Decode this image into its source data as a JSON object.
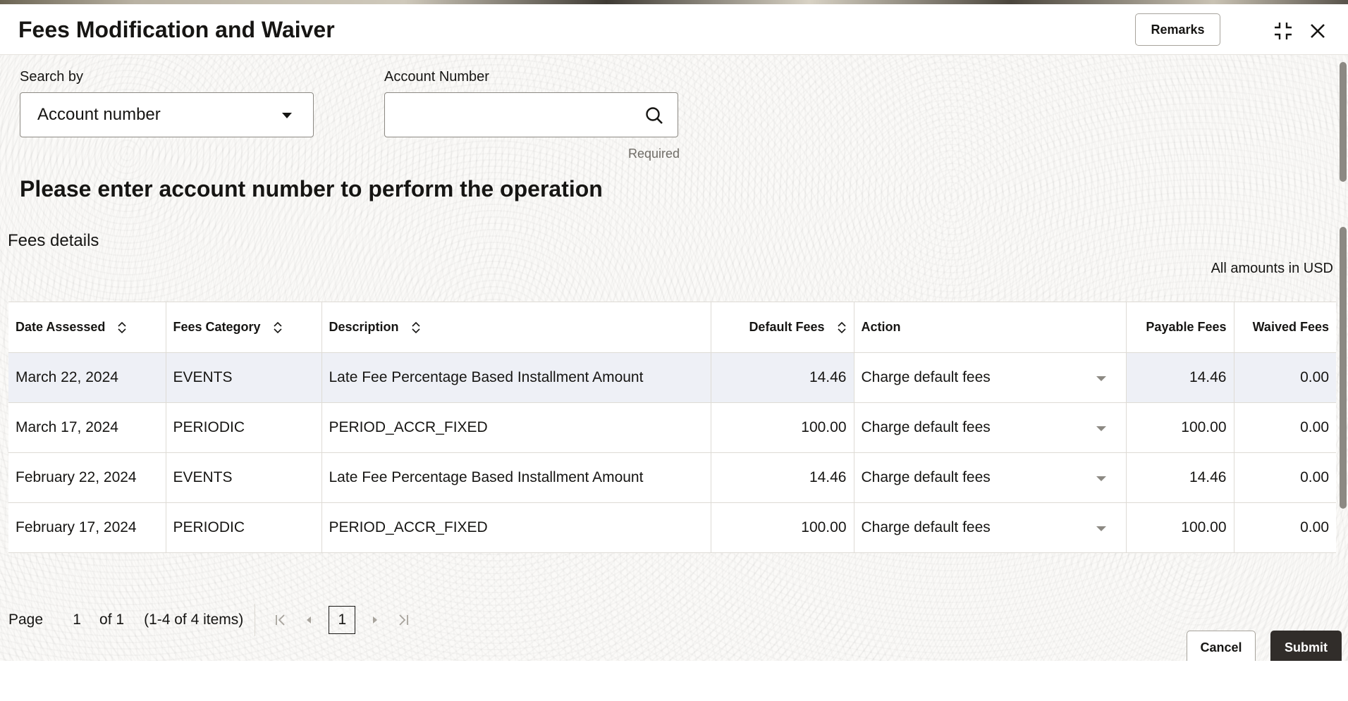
{
  "dialog": {
    "title": "Fees Modification and Waiver",
    "remarks_label": "Remarks",
    "minimize_icon": "collapse-icon",
    "close_icon": "close-icon"
  },
  "search": {
    "search_by_label": "Search by",
    "search_by_value": "Account number",
    "account_label": "Account Number",
    "account_value": "",
    "required_text": "Required"
  },
  "message": "Please enter account number to perform the operation",
  "fees": {
    "section_title": "Fees details",
    "amounts_note": "All amounts in USD",
    "columns": {
      "date": "Date Assessed",
      "category": "Fees Category",
      "description": "Description",
      "default": "Default Fees",
      "action": "Action",
      "payable": "Payable Fees",
      "waived": "Waived Fees"
    },
    "rows": [
      {
        "date": "March 22, 2024",
        "category": "EVENTS",
        "description": "Late Fee Percentage Based Installment Amount",
        "default": "14.46",
        "action": "Charge default fees",
        "payable": "14.46",
        "waived": "0.00"
      },
      {
        "date": "March 17, 2024",
        "category": "PERIODIC",
        "description": "PERIOD_ACCR_FIXED",
        "default": "100.00",
        "action": "Charge default fees",
        "payable": "100.00",
        "waived": "0.00"
      },
      {
        "date": "February 22, 2024",
        "category": "EVENTS",
        "description": "Late Fee Percentage Based Installment Amount",
        "default": "14.46",
        "action": "Charge default fees",
        "payable": "14.46",
        "waived": "0.00"
      },
      {
        "date": "February 17, 2024",
        "category": "PERIODIC",
        "description": "PERIOD_ACCR_FIXED",
        "default": "100.00",
        "action": "Charge default fees",
        "payable": "100.00",
        "waived": "0.00"
      }
    ]
  },
  "pager": {
    "page_label": "Page",
    "current_page": "1",
    "of_text": "of 1",
    "items_text": "(1-4 of 4 items)",
    "page_button": "1"
  },
  "footer": {
    "cancel_label": "Cancel",
    "submit_label": "Submit"
  }
}
